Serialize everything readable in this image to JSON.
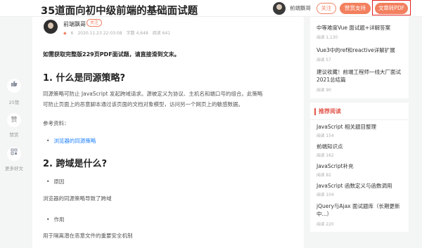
{
  "header": {
    "title": "35道面向初中级前端的基础面试题",
    "author": "前端飘哥",
    "follow_label": "关注",
    "support_label": "赞赏支持",
    "pdf_label": "文章转PDF"
  },
  "rail": {
    "like_count": "25赞",
    "reward_label": "赞赏",
    "reward_text": "赞",
    "more_label": "更多好文"
  },
  "article": {
    "author": "前端飘哥",
    "author_tag": "关注",
    "likes": "6",
    "date": "2020.11.23 22:03:08",
    "words": "字数 4,648",
    "reads": "阅读 641",
    "notice": "如需获取完整版229页PDF面试题，请直接滑到文末。",
    "h1": "1. 什么是同源策略?",
    "p1_line1": "同源策略可防止 JavaScript 发起跨域请求。源被定义为协议、主机名和端口号的组合。此策略",
    "p1_line2": "可防止页面上的恶意脚本通过该页面的文档对象模型，访问另一个网页上的敏感数据。",
    "ref_label": "参考资料：",
    "ref_link": "浏览器的同源策略",
    "h2": "2. 跨域是什么?",
    "bullet1": "原因",
    "p2": "浏览器的同源策略导致了跨域",
    "bullet2": "作用",
    "p3": "用于隔离潜在恶意文件的重要安全机制"
  },
  "sidebar_top": [
    {
      "title": "中等难度Vue 面试题+详解答案",
      "reads": "阅读 1,130"
    },
    {
      "title": "Vue3中的ref和reactive详解扩展",
      "reads": "阅读 57"
    },
    {
      "title_line1": "建议收藏！前端工程师一线大厂面试",
      "title_line2": "2021总结篇",
      "reads": "阅读 90"
    }
  ],
  "recommend": {
    "heading": "推荐阅读",
    "items": [
      {
        "title": "JavaScript 相关题目整理",
        "reads": "阅读 154"
      },
      {
        "title": "前端知识点",
        "reads": "阅读 162"
      },
      {
        "title": "JavaScript补充",
        "reads": "阅读 82"
      },
      {
        "title": "JavaScript 函数定义与函数调用",
        "reads": "阅读 104"
      },
      {
        "title_line1": "jQuery与Ajax 面试题库（长期更新",
        "title_line2": "中...）",
        "reads": "阅读 220"
      }
    ]
  }
}
